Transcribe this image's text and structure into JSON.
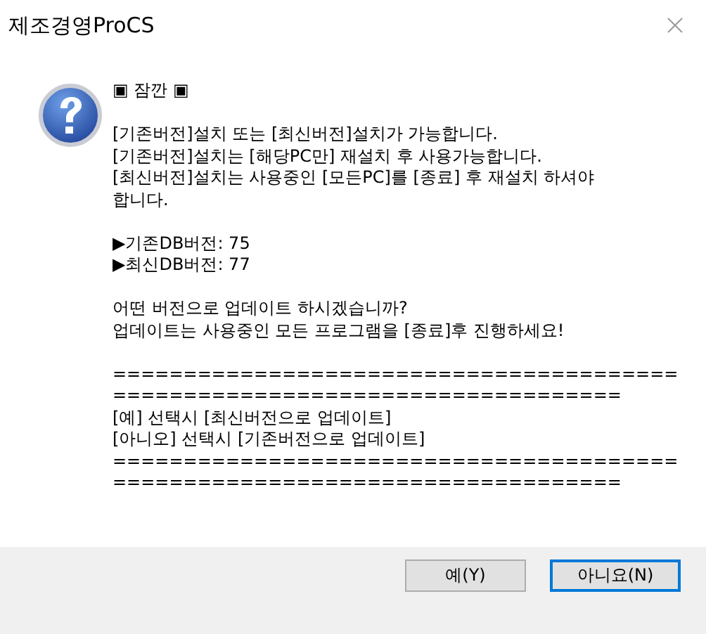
{
  "window": {
    "title": "제조경영ProCS"
  },
  "message": {
    "blocks": [
      [
        "▣ 잠깐 ▣"
      ],
      [
        "[기존버전]설치 또는 [최신버전]설치가 가능합니다.",
        "[기존버전]설치는 [해당PC만] 재설치 후 사용가능합니다.",
        "[최신버전]설치는 사용중인 [모든PC]를 [종료] 후 재설치 하셔야",
        "합니다."
      ],
      [
        "▶기존DB버전: 75",
        "▶최신DB버전: 77"
      ],
      [
        "어떤 버전으로 업데이트 하시겠습니까?",
        "업데이트는 사용중인 모든 프로그램을 [종료]후 진행하세요!"
      ],
      [
        "========================================",
        "====================================",
        "[예] 선택시 [최신버전으로 업데이트]",
        "[아니오] 선택시 [기존버전으로 업데이트]",
        "========================================",
        "===================================="
      ]
    ]
  },
  "buttons": [
    {
      "label": "예(Y)",
      "selected": false
    },
    {
      "label": "아니요(N)",
      "selected": true
    }
  ]
}
